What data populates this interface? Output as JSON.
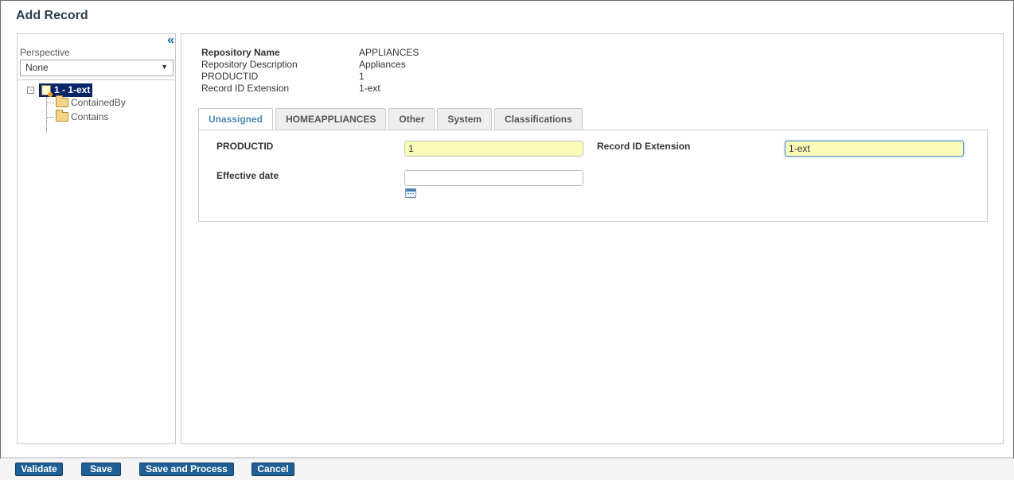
{
  "page": {
    "title": "Add Record"
  },
  "left": {
    "collapse_glyph": "«",
    "perspective_label": "Perspective",
    "perspective_value": "None",
    "tree": {
      "root_label": "1 - 1-ext",
      "root_expander": "-",
      "children": [
        "ContainedBy",
        "Contains"
      ]
    }
  },
  "info": {
    "rows": [
      {
        "label": "Repository Name",
        "value": "APPLIANCES"
      },
      {
        "label": "Repository Description",
        "value": "Appliances"
      },
      {
        "label": "PRODUCTID",
        "value": "1"
      },
      {
        "label": "Record ID Extension",
        "value": "1-ext"
      }
    ]
  },
  "tabs": [
    "Unassigned",
    "HOMEAPPLIANCES",
    "Other",
    "System",
    "Classifications"
  ],
  "active_tab": "Unassigned",
  "form": {
    "productid_label": "PRODUCTID",
    "productid_value": "1",
    "recext_label": "Record ID Extension",
    "recext_value": "1-ext",
    "effdate_label": "Effective date",
    "effdate_value": ""
  },
  "footer": {
    "buttons": [
      "Validate",
      "Save",
      "Save and Process",
      "Cancel"
    ]
  },
  "colors": {
    "button_bg": "#1f5f95",
    "active_tab_text": "#4a8ab8",
    "required_field_bg": "#fbfbb8",
    "tree_selected_bg": "#0a246a"
  }
}
